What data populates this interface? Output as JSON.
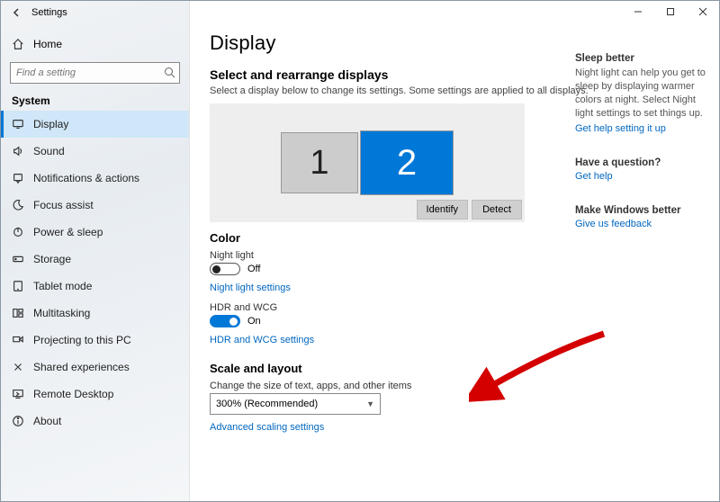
{
  "window": {
    "title": "Settings"
  },
  "sidebar": {
    "home": "Home",
    "search_placeholder": "Find a setting",
    "category": "System",
    "items": [
      {
        "label": "Display",
        "icon": "display",
        "active": true
      },
      {
        "label": "Sound",
        "icon": "sound",
        "active": false
      },
      {
        "label": "Notifications & actions",
        "icon": "notify",
        "active": false
      },
      {
        "label": "Focus assist",
        "icon": "moon",
        "active": false
      },
      {
        "label": "Power & sleep",
        "icon": "power",
        "active": false
      },
      {
        "label": "Storage",
        "icon": "storage",
        "active": false
      },
      {
        "label": "Tablet mode",
        "icon": "tablet",
        "active": false
      },
      {
        "label": "Multitasking",
        "icon": "multitask",
        "active": false
      },
      {
        "label": "Projecting to this PC",
        "icon": "project",
        "active": false
      },
      {
        "label": "Shared experiences",
        "icon": "share",
        "active": false
      },
      {
        "label": "Remote Desktop",
        "icon": "remote",
        "active": false
      },
      {
        "label": "About",
        "icon": "about",
        "active": false
      }
    ]
  },
  "main": {
    "heading": "Display",
    "arrange": {
      "title": "Select and rearrange displays",
      "desc": "Select a display below to change its settings. Some settings are applied to all displays.",
      "displays": [
        {
          "number": "1",
          "selected": false
        },
        {
          "number": "2",
          "selected": true
        }
      ],
      "identify": "Identify",
      "detect": "Detect"
    },
    "color": {
      "title": "Color",
      "night_light_label": "Night light",
      "night_light_state": "Off",
      "night_light_link": "Night light settings",
      "hdr_label": "HDR and WCG",
      "hdr_state": "On",
      "hdr_link": "HDR and WCG settings"
    },
    "scale": {
      "title": "Scale and layout",
      "size_label": "Change the size of text, apps, and other items",
      "size_value": "300% (Recommended)",
      "advanced_link": "Advanced scaling settings"
    }
  },
  "aside": {
    "sleep": {
      "title": "Sleep better",
      "body": "Night light can help you get to sleep by displaying warmer colors at night. Select Night light settings to set things up.",
      "link": "Get help setting it up"
    },
    "question": {
      "title": "Have a question?",
      "link": "Get help"
    },
    "better": {
      "title": "Make Windows better",
      "link": "Give us feedback"
    }
  }
}
